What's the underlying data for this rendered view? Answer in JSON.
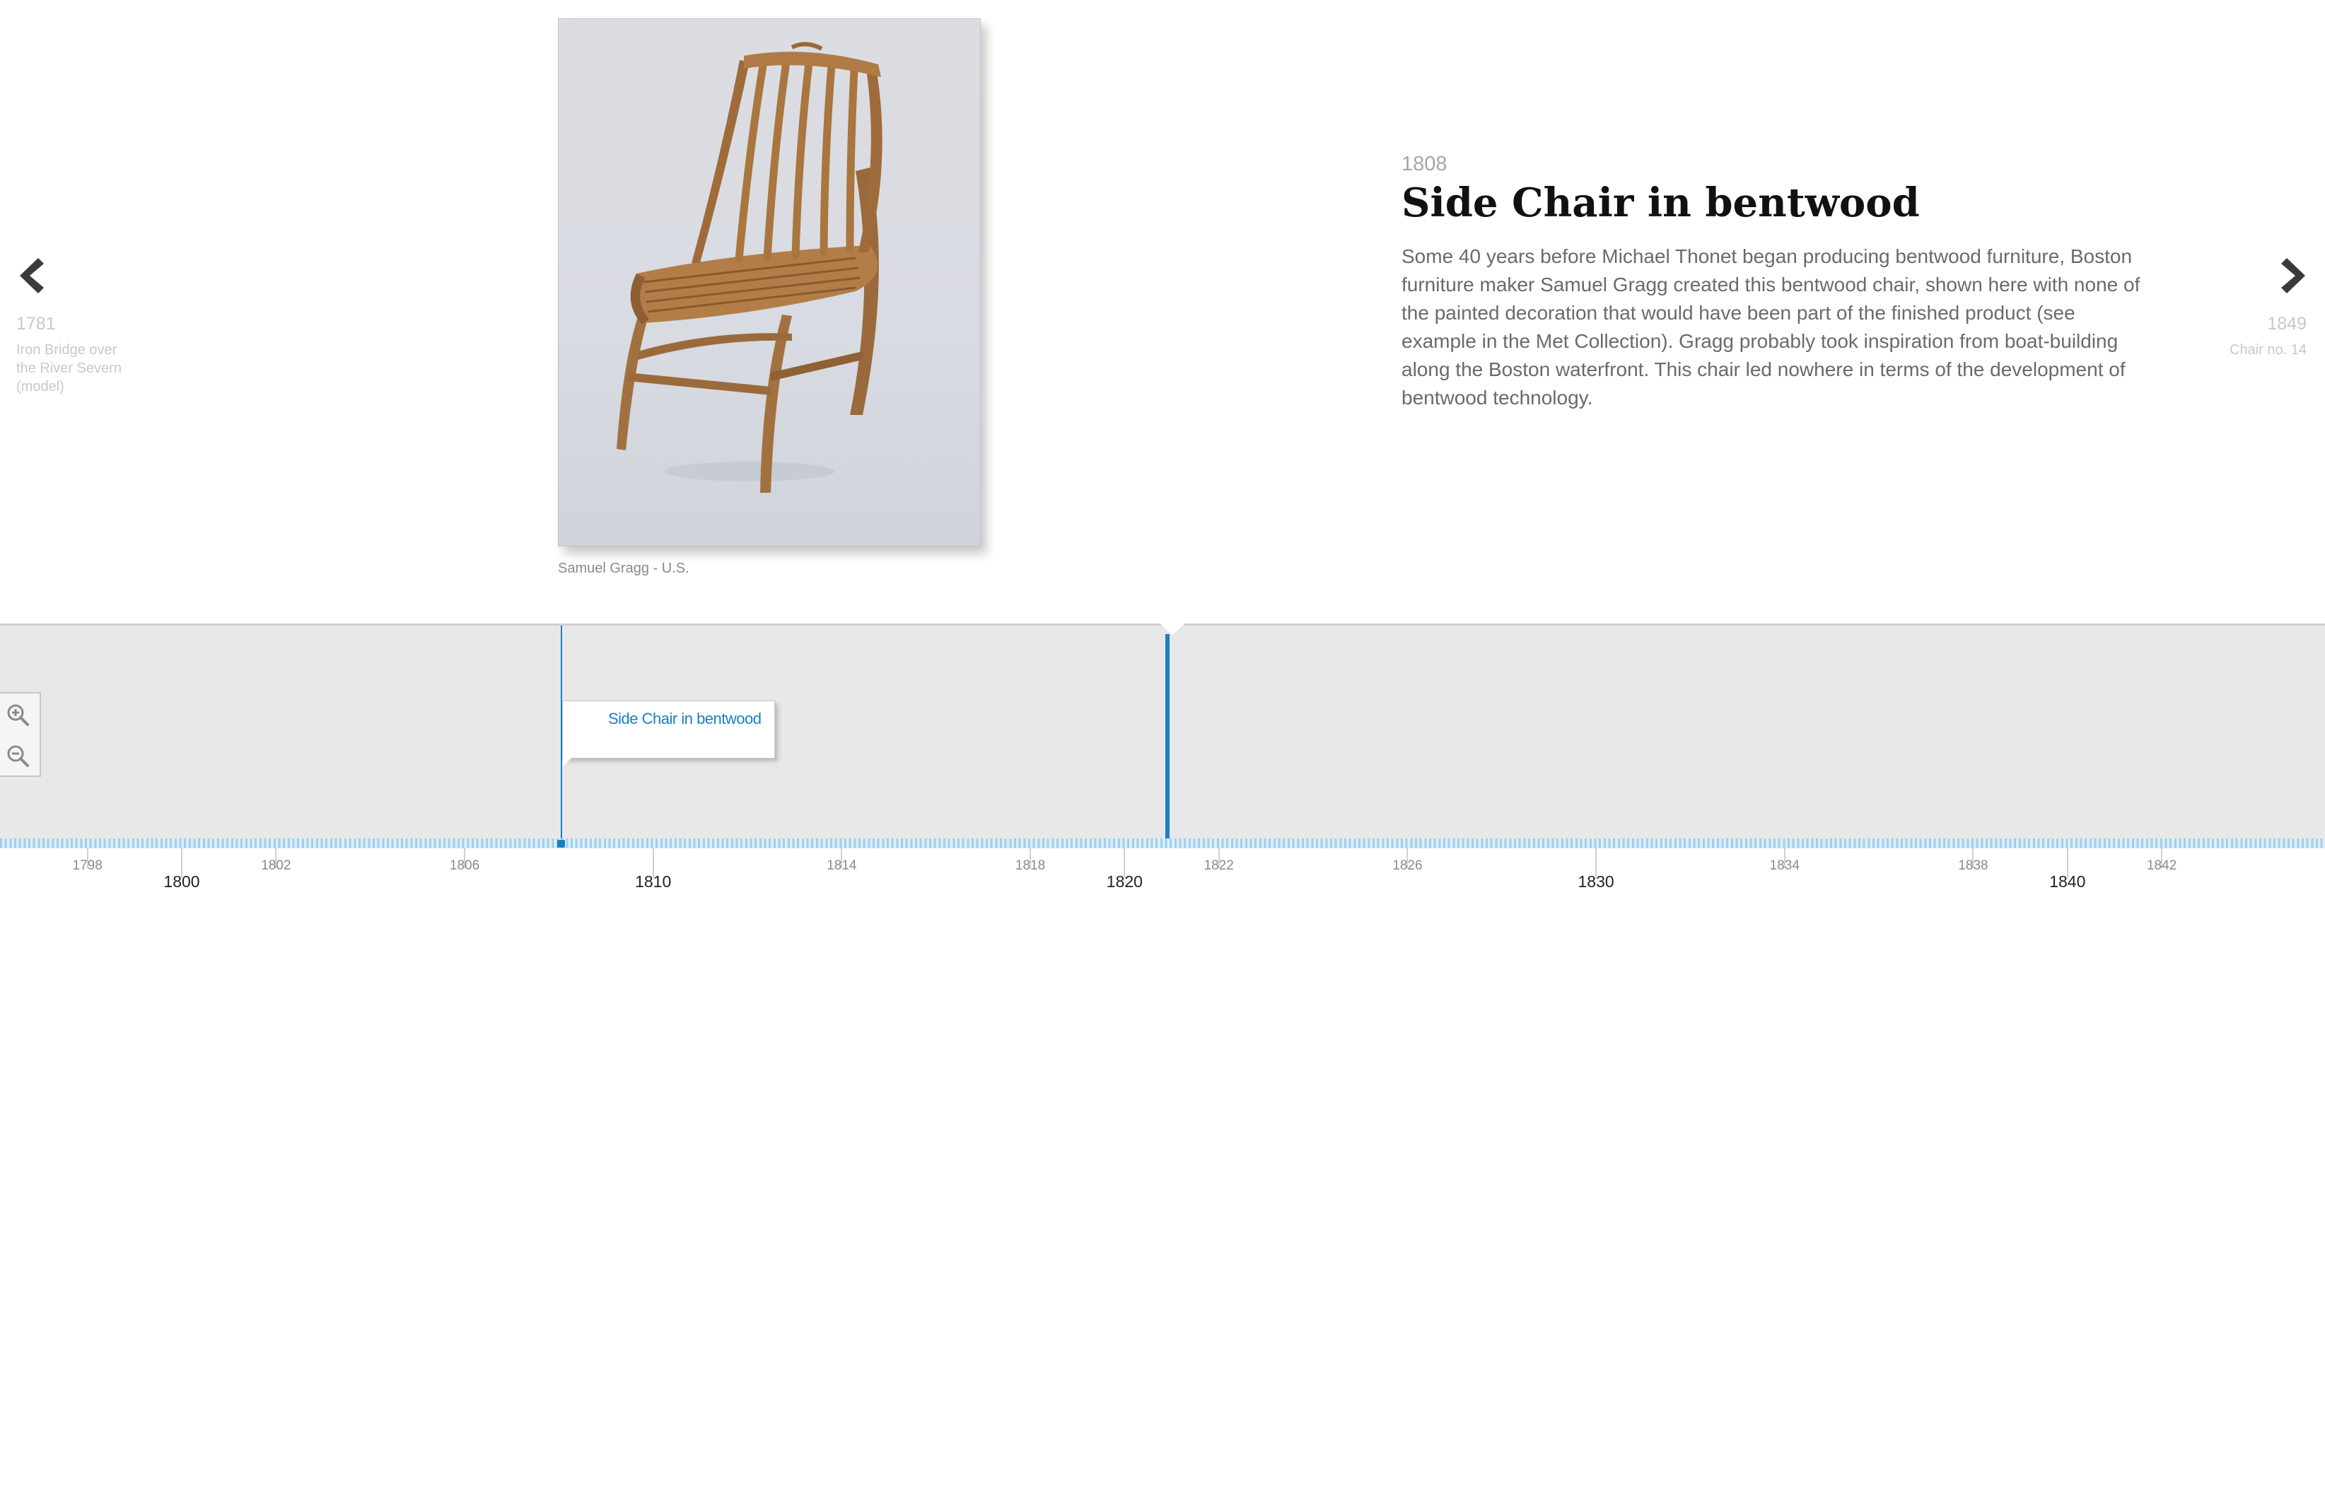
{
  "prev_slide": {
    "date": "1781",
    "title": "Iron Bridge over the River Severn (model)"
  },
  "next_slide": {
    "date": "1849",
    "title": "Chair no. 14"
  },
  "slide": {
    "date": "1808",
    "headline": "Side Chair in bentwood",
    "body": "Some 40 years before Michael Thonet began producing bentwood furniture, Boston furniture maker Samuel Gragg created this bentwood chair, shown here with none of the painted decoration that would have been part of the finished product (see example in the Met Collection). Gragg probably took inspiration from boat-building along the Boston waterfront. This chair led nowhere in terms of the development of bentwood technology.",
    "media_credit": "Samuel Gragg - U.S."
  },
  "timeline": {
    "event_label": "Side Chair in bentwood",
    "major_years": [
      "1800",
      "1810",
      "1820",
      "1830",
      "1840"
    ],
    "minor_years": [
      "1798",
      "1802",
      "1806",
      "1814",
      "1818",
      "1822",
      "1826",
      "1834",
      "1838",
      "1842"
    ],
    "zoom_in_icon": "zoom-in-icon",
    "zoom_out_icon": "zoom-out-icon"
  },
  "colors": {
    "accent": "#1b7fc4",
    "timeline_bg": "#e8e8e8",
    "muted_text": "#c8c8c8"
  }
}
